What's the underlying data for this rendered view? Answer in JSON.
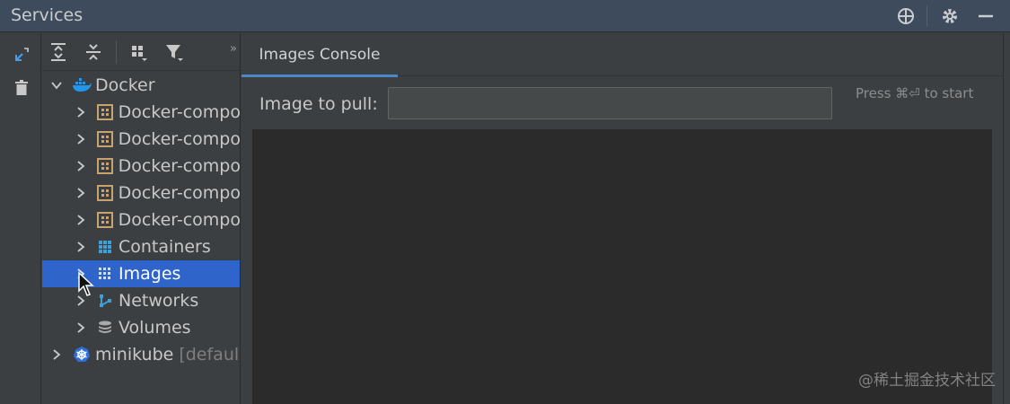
{
  "window": {
    "title": "Services"
  },
  "titlebar_icons": [
    "target-icon",
    "gear-icon",
    "minimize-icon"
  ],
  "strip": {
    "buttons": [
      "expand-diagonal-icon",
      "trash-icon"
    ]
  },
  "tree_toolbar": {
    "buttons": [
      "expand-all-icon",
      "collapse-all-icon",
      "group-by-icon",
      "filter-icon"
    ],
    "more": "»"
  },
  "tree": {
    "docker": {
      "label": "Docker"
    },
    "compose": [
      {
        "label": "Docker-compo"
      },
      {
        "label": "Docker-compo"
      },
      {
        "label": "Docker-compo"
      },
      {
        "label": "Docker-compo"
      },
      {
        "label": "Docker-compo"
      }
    ],
    "containers": {
      "label": "Containers"
    },
    "images": {
      "label": "Images"
    },
    "networks": {
      "label": "Networks"
    },
    "volumes": {
      "label": "Volumes"
    },
    "minikube": {
      "label": "minikube",
      "suffix": "[defaul"
    }
  },
  "panel": {
    "tab": {
      "label": "Images Console"
    },
    "pull": {
      "label": "Image to pull:",
      "value": "",
      "hint": "Press ⌘⏎ to start"
    }
  },
  "watermark": "@稀土掘金技术社区",
  "colors": {
    "selection": "#2f65ca",
    "accent": "#4a88c7",
    "docker_blue": "#2396ed",
    "compose_orange": "#c9a26d"
  }
}
